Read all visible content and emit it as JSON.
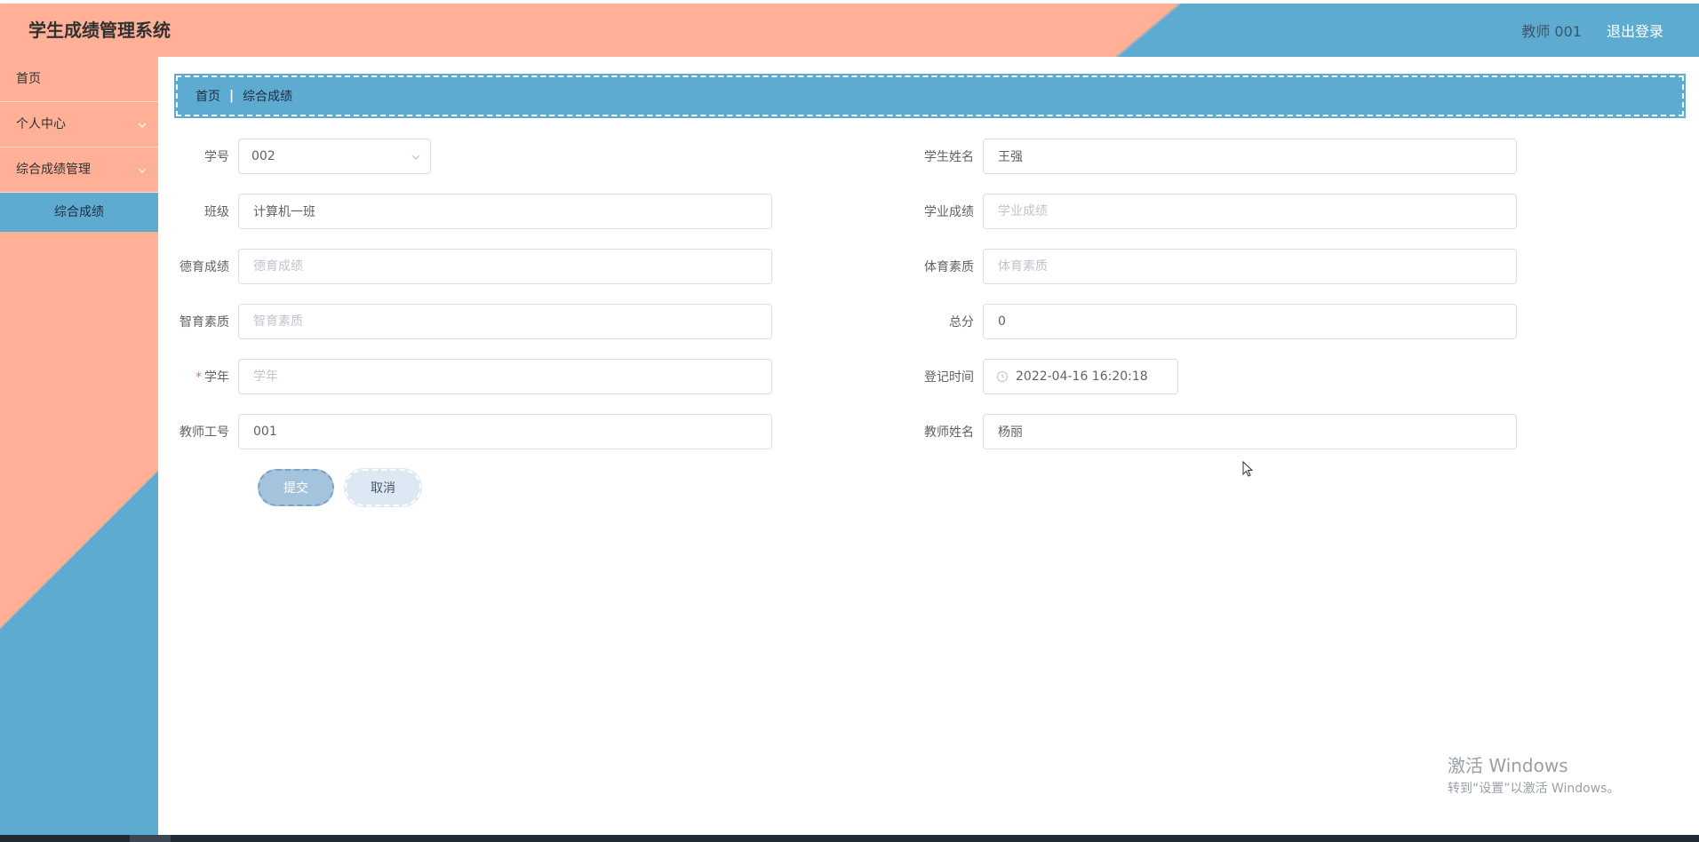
{
  "header": {
    "title": "学生成绩管理系统",
    "user": "教师 001",
    "logout": "退出登录"
  },
  "sidebar": {
    "items": [
      {
        "label": "首页"
      },
      {
        "label": "个人中心",
        "icon": "chevron-down-icon"
      },
      {
        "label": "综合成绩管理",
        "icon": "chevron-down-icon"
      }
    ],
    "sub_items": [
      {
        "label": "综合成绩"
      }
    ]
  },
  "breadcrumb": {
    "home": "首页",
    "current": "综合成绩"
  },
  "form": {
    "student_id": {
      "label": "学号",
      "value": "002"
    },
    "student_name": {
      "label": "学生姓名",
      "value": "王强"
    },
    "class": {
      "label": "班级",
      "value": "计算机一班"
    },
    "academic_score": {
      "label": "学业成绩",
      "placeholder": "学业成绩",
      "value": ""
    },
    "moral_score": {
      "label": "德育成绩",
      "placeholder": "德育成绩",
      "value": ""
    },
    "pe_quality": {
      "label": "体育素质",
      "placeholder": "体育素质",
      "value": ""
    },
    "intellectual_quality": {
      "label": "智育素质",
      "placeholder": "智育素质",
      "value": ""
    },
    "total": {
      "label": "总分",
      "value": "0"
    },
    "academic_year": {
      "label": "学年",
      "placeholder": "学年",
      "value": "",
      "required": true,
      "required_mark": "*"
    },
    "register_time": {
      "label": "登记时间",
      "value": "2022-04-16 16:20:18",
      "icon": "clock-icon"
    },
    "teacher_id": {
      "label": "教师工号",
      "value": "001"
    },
    "teacher_name": {
      "label": "教师姓名",
      "value": "杨丽"
    }
  },
  "actions": {
    "submit": "提交",
    "cancel": "取消"
  },
  "watermark": {
    "line1": "激活 Windows",
    "line2": "转到“设置”以激活 Windows。"
  },
  "colors": {
    "salmon": "#ffb096",
    "blue": "#5eabd2",
    "submit_bg": "#a4c3dc",
    "cancel_bg": "#dce9f5"
  }
}
